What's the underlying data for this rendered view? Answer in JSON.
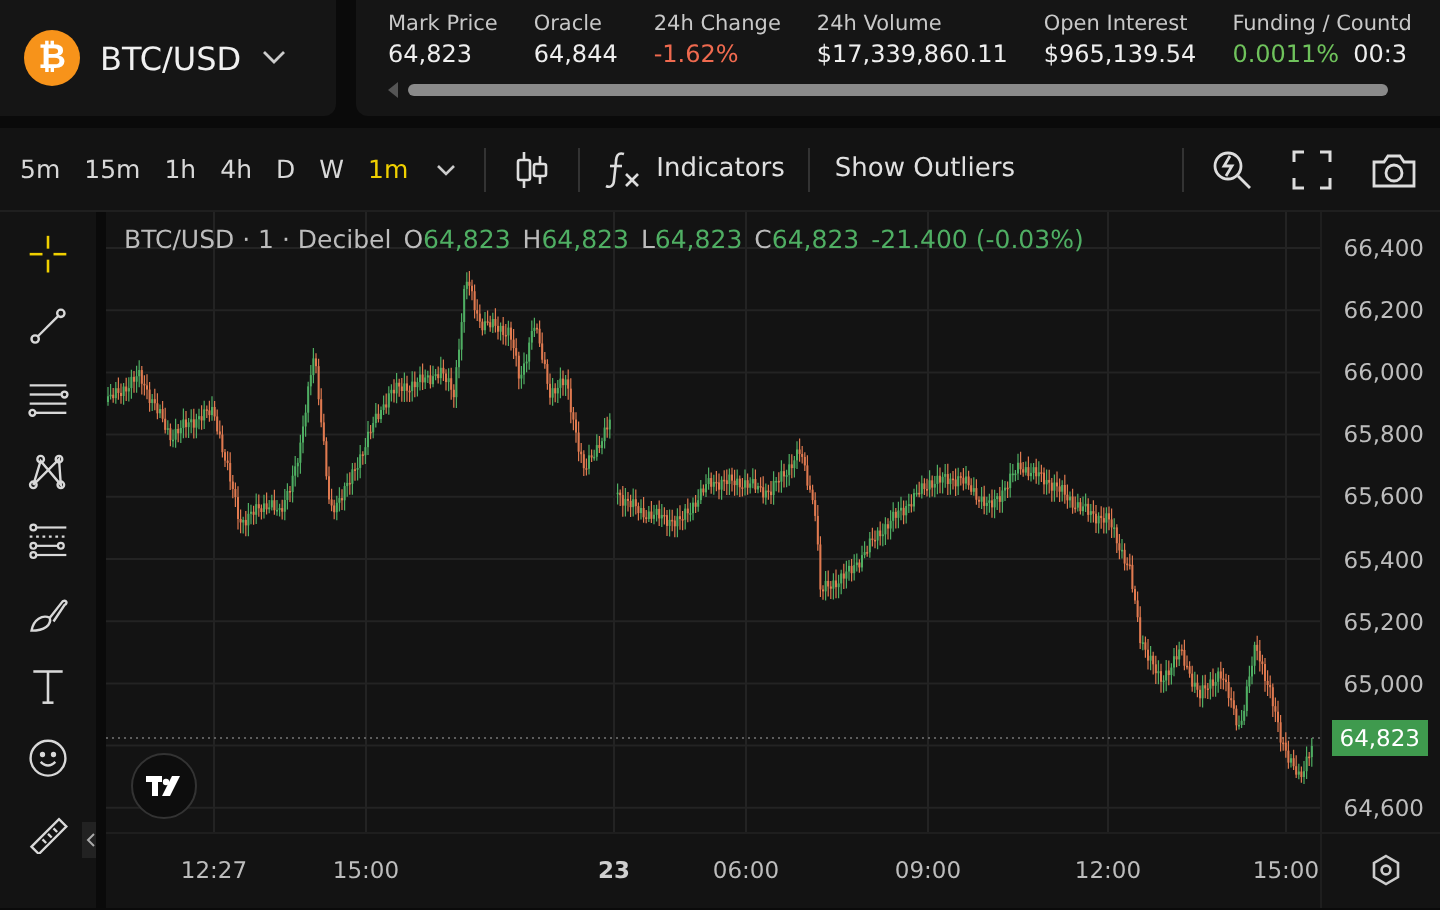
{
  "market": {
    "symbol": "₿",
    "title": "BTC/USD"
  },
  "stats": [
    {
      "label": "Mark Price",
      "value": "64,823",
      "color": "#eeeeee"
    },
    {
      "label": "Oracle",
      "value": "64,844",
      "color": "#eeeeee"
    },
    {
      "label": "24h Change",
      "value": "-1.62%",
      "color": "#ef6a4f"
    },
    {
      "label": "24h Volume",
      "value": "$17,339,860.11",
      "color": "#eeeeee"
    },
    {
      "label": "Open Interest",
      "value": "$965,139.54",
      "color": "#eeeeee"
    },
    {
      "label": "Funding / Countd",
      "value": "0.0011%",
      "value_2": "00:3",
      "color": "#6fc25c"
    }
  ],
  "intervals": [
    {
      "label": "5m",
      "selected": false
    },
    {
      "label": "15m",
      "selected": false
    },
    {
      "label": "1h",
      "selected": false
    },
    {
      "label": "4h",
      "selected": false
    },
    {
      "label": "D",
      "selected": false
    },
    {
      "label": "W",
      "selected": false
    },
    {
      "label": "1m",
      "selected": true
    }
  ],
  "toolbar": {
    "indicators": "Indicators",
    "outliers": "Show Outliers"
  },
  "tools": [
    {
      "kind": "crosshair",
      "selected": true
    },
    {
      "kind": "trendline",
      "selected": false
    },
    {
      "kind": "hlines",
      "selected": false
    },
    {
      "kind": "pattern",
      "selected": false
    },
    {
      "kind": "fib",
      "selected": false
    },
    {
      "kind": "brush",
      "selected": false
    },
    {
      "kind": "text",
      "selected": false
    },
    {
      "kind": "emoji",
      "selected": false
    },
    {
      "kind": "ruler",
      "selected": false
    }
  ],
  "legend": {
    "title": "BTC/USD · 1 · Decibel",
    "ohlc": [
      {
        "key": "O",
        "value": "64,823"
      },
      {
        "key": "H",
        "value": "64,823"
      },
      {
        "key": "L",
        "value": "64,823"
      },
      {
        "key": "C",
        "value": "64,823"
      }
    ],
    "change": "-21.400 (-0.03%)"
  },
  "price_axis": [
    "66,400",
    "66,200",
    "66,000",
    "65,800",
    "65,600",
    "65,400",
    "65,200",
    "65,000",
    "64,600"
  ],
  "last_price": "64,823",
  "time_axis": [
    {
      "label": "12:27",
      "bold": false
    },
    {
      "label": "15:00",
      "bold": false
    },
    {
      "label": "23",
      "bold": true
    },
    {
      "label": "06:00",
      "bold": false
    },
    {
      "label": "09:00",
      "bold": false
    },
    {
      "label": "12:00",
      "bold": false
    },
    {
      "label": "15:00",
      "bold": false
    }
  ]
}
